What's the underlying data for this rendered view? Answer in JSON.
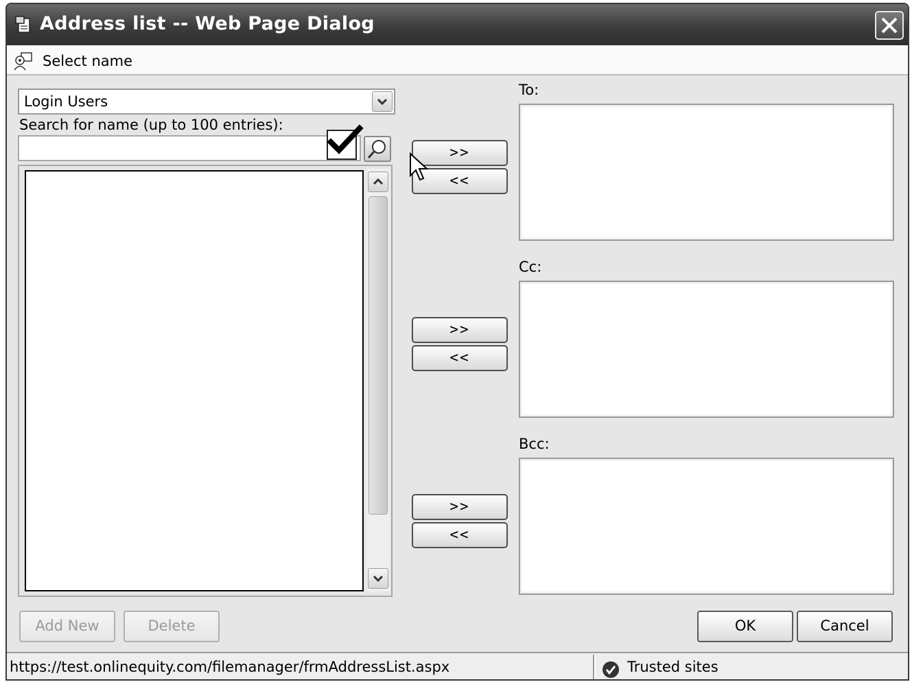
{
  "window": {
    "title": "Address list -- Web Page Dialog"
  },
  "header": {
    "title": "Select name"
  },
  "source": {
    "selected": "Login Users",
    "search_label": "Search for name (up to 100 entries):",
    "search_value": "",
    "checkbox_checked": true
  },
  "transfer": {
    "add_label": ">>",
    "remove_label": "<<"
  },
  "recipients": {
    "to_label": "To:",
    "cc_label": "Cc:",
    "bcc_label": "Bcc:"
  },
  "actions": {
    "add_new": "Add New",
    "delete": "Delete",
    "ok": "OK",
    "cancel": "Cancel"
  },
  "status": {
    "url": "https://test.onlinequity.com/filemanager/frmAddressList.aspx",
    "zone": "Trusted sites"
  },
  "icons": {
    "title": "page-icon",
    "close": "close-icon",
    "header": "contacts-icon",
    "dropdown": "chevron-down-icon",
    "search": "magnifier-icon",
    "check": "checkmark-icon",
    "scroll_up": "chevron-up-icon",
    "scroll_down": "chevron-down-icon",
    "zone": "check-shield-icon"
  }
}
